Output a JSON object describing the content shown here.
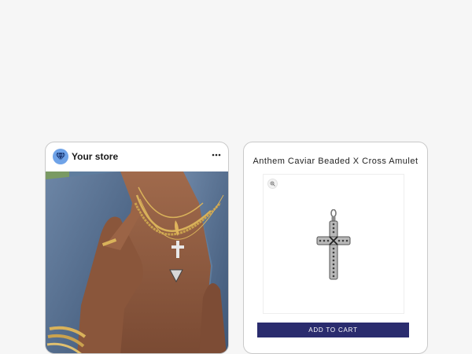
{
  "instagram_card": {
    "store_name": "Your store",
    "avatar_icon": "diamond-icon",
    "menu_icon": "more-horizontal-icon",
    "photo_description": "jewelry-model-photo"
  },
  "product_card": {
    "title": "Anthem Caviar Beaded X Cross Amulet",
    "zoom_icon": "zoom-in-icon",
    "add_to_cart_label": "ADD TO CART",
    "button_color": "#2a2c6e"
  },
  "colors": {
    "background": "#f6f6f6",
    "avatar": "#6fa3e8",
    "accent": "#2a2c6e"
  }
}
